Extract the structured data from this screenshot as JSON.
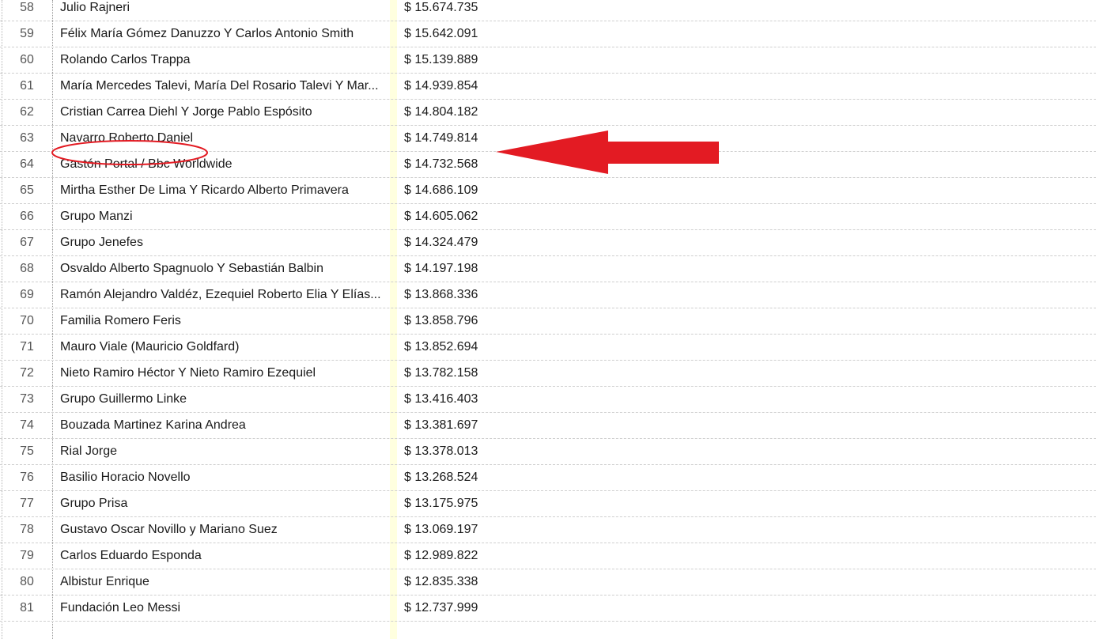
{
  "table": {
    "rows": [
      {
        "num": "58",
        "name": "Julio Rajneri",
        "amount": "$ 15.674.735"
      },
      {
        "num": "59",
        "name": "Félix María Gómez Danuzzo Y Carlos Antonio Smith",
        "amount": "$ 15.642.091"
      },
      {
        "num": "60",
        "name": "Rolando Carlos Trappa",
        "amount": "$ 15.139.889"
      },
      {
        "num": "61",
        "name": "María Mercedes Talevi, María Del Rosario Talevi Y Mar...",
        "amount": "$ 14.939.854"
      },
      {
        "num": "62",
        "name": "Cristian Carrea Diehl Y Jorge Pablo Espósito",
        "amount": "$ 14.804.182"
      },
      {
        "num": "63",
        "name": "Navarro Roberto Daniel",
        "amount": "$ 14.749.814"
      },
      {
        "num": "64",
        "name": "Gastón Portal / Bbc Worldwide",
        "amount": "$ 14.732.568"
      },
      {
        "num": "65",
        "name": "Mirtha Esther De Lima Y Ricardo Alberto Primavera",
        "amount": "$ 14.686.109"
      },
      {
        "num": "66",
        "name": "Grupo Manzi",
        "amount": "$ 14.605.062"
      },
      {
        "num": "67",
        "name": "Grupo Jenefes",
        "amount": "$ 14.324.479"
      },
      {
        "num": "68",
        "name": "Osvaldo Alberto Spagnuolo Y Sebastián Balbin",
        "amount": "$ 14.197.198"
      },
      {
        "num": "69",
        "name": "Ramón Alejandro Valdéz, Ezequiel Roberto Elia Y Elías...",
        "amount": "$ 13.868.336"
      },
      {
        "num": "70",
        "name": "Familia Romero Feris",
        "amount": "$ 13.858.796"
      },
      {
        "num": "71",
        "name": "Mauro Viale (Mauricio Goldfard)",
        "amount": "$ 13.852.694"
      },
      {
        "num": "72",
        "name": "Nieto Ramiro Héctor Y Nieto Ramiro Ezequiel",
        "amount": "$ 13.782.158"
      },
      {
        "num": "73",
        "name": "Grupo Guillermo Linke",
        "amount": "$ 13.416.403"
      },
      {
        "num": "74",
        "name": "Bouzada Martinez Karina Andrea",
        "amount": "$ 13.381.697"
      },
      {
        "num": "75",
        "name": "Rial Jorge",
        "amount": "$ 13.378.013"
      },
      {
        "num": "76",
        "name": "Basilio Horacio Novello",
        "amount": "$ 13.268.524"
      },
      {
        "num": "77",
        "name": "Grupo Prisa",
        "amount": "$ 13.175.975"
      },
      {
        "num": "78",
        "name": "Gustavo Oscar Novillo y Mariano Suez",
        "amount": "$ 13.069.197"
      },
      {
        "num": "79",
        "name": "Carlos Eduardo Esponda",
        "amount": "$ 12.989.822"
      },
      {
        "num": "80",
        "name": "Albistur Enrique",
        "amount": "$ 12.835.338"
      },
      {
        "num": "81",
        "name": "Fundación Leo Messi",
        "amount": "$ 12.737.999"
      }
    ]
  },
  "highlight": {
    "row_num": "63",
    "annotation_color": "#e31b23",
    "annotation_icons": [
      "ellipse-highlight-icon",
      "red-arrow-icon"
    ]
  },
  "colors": {
    "amount_column_tint": "#ffffdf",
    "row_divider": "#cfcfcf"
  }
}
